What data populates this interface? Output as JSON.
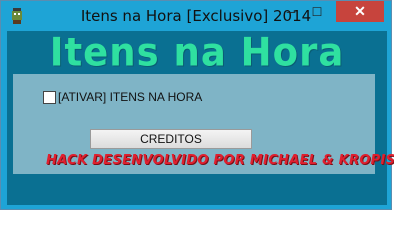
{
  "window": {
    "title": "Itens na Hora [Exclusivo] 2014",
    "controls": {
      "minimize": "─",
      "maximize": "☐",
      "close": "✕"
    }
  },
  "banner": {
    "text": "Itens na Hora"
  },
  "checkbox": {
    "label": "[ATIVAR] ITENS NA HORA",
    "checked": false
  },
  "credits_button": {
    "label": "CREDITOS"
  },
  "credit_text": "HACK DESENVOLVIDO POR MICHAEL & KROPIS",
  "colors": {
    "titlebar": "#1ea4d6",
    "client": "#0a7092",
    "panel": "#7fb4c6",
    "banner_text": "#2fe0a0",
    "credit_text": "#e0202f",
    "close_button": "#c7443d"
  },
  "icons": {
    "app": "app-icon"
  }
}
